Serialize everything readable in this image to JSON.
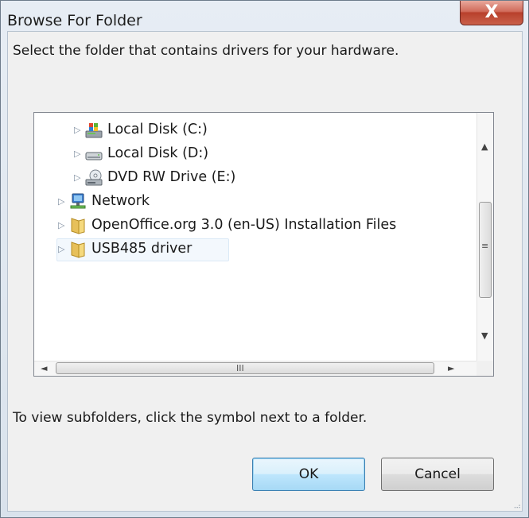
{
  "window": {
    "title": "Browse For Folder",
    "close_label": "X"
  },
  "dialog": {
    "instruction": "Select the folder that contains drivers for your hardware.",
    "hint": "To view subfolders, click the symbol next to a folder."
  },
  "tree": {
    "items": [
      {
        "label": "Local Disk (C:)",
        "icon": "windows-drive-icon"
      },
      {
        "label": "Local Disk (D:)",
        "icon": "hard-drive-icon"
      },
      {
        "label": "DVD RW Drive (E:)",
        "icon": "dvd-drive-icon"
      },
      {
        "label": "Network",
        "icon": "network-icon"
      },
      {
        "label": "OpenOffice.org 3.0 (en-US) Installation Files",
        "icon": "folder-icon"
      },
      {
        "label": "USB485 driver",
        "icon": "folder-icon",
        "selected": true
      }
    ],
    "scroll_glyphs": {
      "up": "▲",
      "down": "▼",
      "left": "◄",
      "right": "►",
      "v_grip": "≡",
      "h_grip": "III"
    }
  },
  "buttons": {
    "ok": "OK",
    "cancel": "Cancel"
  },
  "colors": {
    "selection": "#f3f8fd",
    "close_button": "#c9604a",
    "default_button_border": "#3c7fb1"
  }
}
